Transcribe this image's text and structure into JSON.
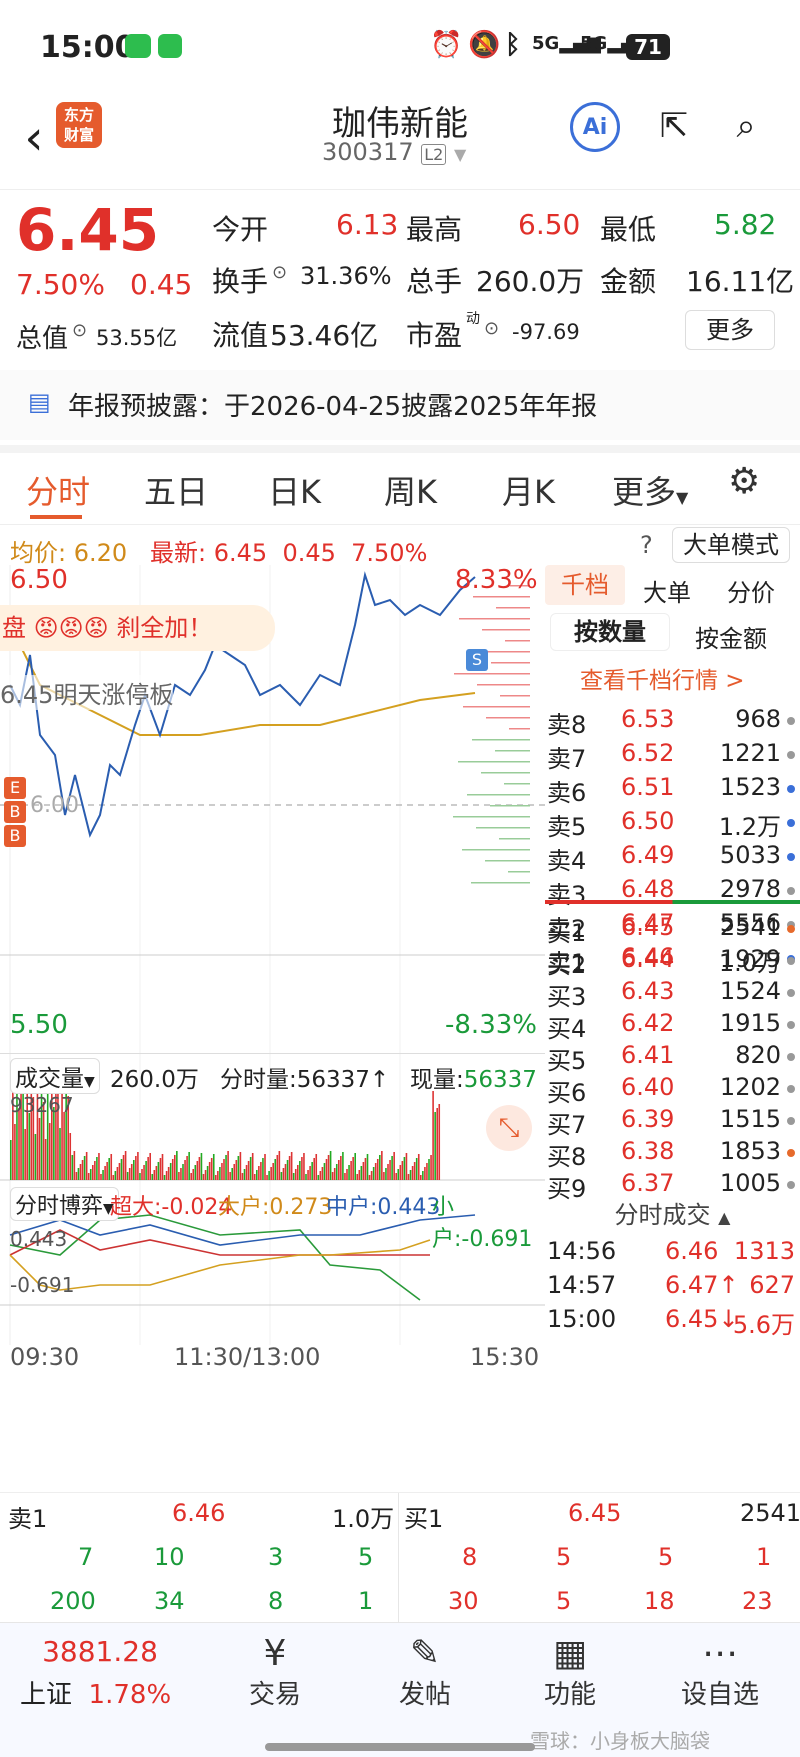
{
  "status": {
    "time": "15:00",
    "battery": "71",
    "network": "5G"
  },
  "header": {
    "logo_line1": "东方",
    "logo_line2": "财富",
    "stock_name": "珈伟新能",
    "stock_code": "300317",
    "level": "L2",
    "ai_label": "Ai"
  },
  "quote": {
    "price": "6.45",
    "change_pct": "7.50%",
    "change": "0.45",
    "open_label": "今开",
    "open": "6.13",
    "high_label": "最高",
    "high": "6.50",
    "low_label": "最低",
    "low": "5.82",
    "turnover_label": "换手",
    "turnover": "31.36%",
    "vol_label": "总手",
    "vol": "260.0万",
    "amount_label": "金额",
    "amount": "16.11亿",
    "mcap_label": "总值",
    "mcap": "53.55亿",
    "float_label": "流值",
    "float": "53.46亿",
    "pe_label": "市盈",
    "pe_sup": "动",
    "pe": "-97.69",
    "more_button": "更多"
  },
  "notice": {
    "text": "年报预披露：于2026-04-25披露2025年年报"
  },
  "tabs": [
    "分时",
    "五日",
    "日K",
    "周K",
    "月K",
    "更多"
  ],
  "infobar": {
    "avg_label": "均价:",
    "avg": "6.20",
    "latest_label": "最新:",
    "latest": "6.45",
    "chg": "0.45",
    "pct": "7.50%",
    "mode_button": "大单模式"
  },
  "chart": {
    "top_price": "6.50",
    "top_pct": "8.33%",
    "bottom_price": "5.50",
    "bottom_pct": "-8.33%",
    "mid_price": "6.00",
    "banner": "盘 😡😡😡 刹全加！",
    "promo": "6.45明天涨停板",
    "marker_s": "S",
    "markers": [
      "E",
      "B",
      "B"
    ],
    "vol_label": "成交量",
    "vol_total": "260.0万",
    "fs_vol": "分时量:56337↑",
    "now_vol_label": "现量:",
    "now_vol": "56337",
    "vol_max": "93267",
    "game_label": "分时博弈",
    "super_label": "超大:",
    "super_val": "-0.024",
    "big_label": "大户:",
    "big_val": "0.273",
    "mid_label": "中户:",
    "mid_val": "0.443",
    "small_label": "小户:",
    "small_val": "-0.691",
    "game_top": "0.443",
    "game_bottom": "-0.691",
    "time_start": "09:30",
    "time_mid": "11:30/13:00",
    "time_end": "15:30"
  },
  "orderbook": {
    "tabs": [
      "千档",
      "大单",
      "分价"
    ],
    "sub": [
      "按数量",
      "按金额"
    ],
    "link": "查看千档行情 >",
    "asks": [
      {
        "l": "卖8",
        "p": "6.53",
        "v": "968",
        "c": "#999"
      },
      {
        "l": "卖7",
        "p": "6.52",
        "v": "1221",
        "c": "#999"
      },
      {
        "l": "卖6",
        "p": "6.51",
        "v": "1523",
        "c": "#3b6fd8"
      },
      {
        "l": "卖5",
        "p": "6.50",
        "v": "1.2万",
        "c": "#3b6fd8"
      },
      {
        "l": "卖4",
        "p": "6.49",
        "v": "5033",
        "c": "#3b6fd8"
      },
      {
        "l": "卖3",
        "p": "6.48",
        "v": "2978",
        "c": "#999"
      },
      {
        "l": "卖2",
        "p": "6.47",
        "v": "5556",
        "c": "#999"
      },
      {
        "l": "卖1",
        "p": "6.46",
        "v": "1.0万",
        "c": "#3b6fd8"
      }
    ],
    "bids": [
      {
        "l": "买1",
        "p": "6.45",
        "v": "2541",
        "c": "#e66a2c"
      },
      {
        "l": "买2",
        "p": "6.44",
        "v": "1929",
        "c": "#999"
      },
      {
        "l": "买3",
        "p": "6.43",
        "v": "1524",
        "c": "#999"
      },
      {
        "l": "买4",
        "p": "6.42",
        "v": "1915",
        "c": "#999"
      },
      {
        "l": "买5",
        "p": "6.41",
        "v": "820",
        "c": "#999"
      },
      {
        "l": "买6",
        "p": "6.40",
        "v": "1202",
        "c": "#999"
      },
      {
        "l": "买7",
        "p": "6.39",
        "v": "1515",
        "c": "#999"
      },
      {
        "l": "买8",
        "p": "6.38",
        "v": "1853",
        "c": "#e66a2c"
      },
      {
        "l": "买9",
        "p": "6.37",
        "v": "1005",
        "c": "#999"
      }
    ],
    "trades_title": "分时成交",
    "trades": [
      {
        "t": "14:56",
        "p": "6.46",
        "v": "1313"
      },
      {
        "t": "14:57",
        "p": "6.47↑",
        "v": "627"
      },
      {
        "t": "15:00",
        "p": "6.45↓",
        "v": "5.6万"
      }
    ]
  },
  "bottom": {
    "sell1": "卖1",
    "sell1_p": "6.46",
    "sell1_v": "1.0万",
    "buy1": "买1",
    "buy1_p": "6.45",
    "buy1_v": "2541",
    "row1": [
      "7",
      "10",
      "3",
      "5",
      "8",
      "5",
      "5",
      "1"
    ],
    "row2": [
      "200",
      "34",
      "8",
      "1",
      "30",
      "5",
      "18",
      "23"
    ]
  },
  "nav": {
    "index_val": "3881.28",
    "index_name": "上证",
    "index_pct": "1.78%",
    "items": [
      "交易",
      "发帖",
      "功能",
      "设自选"
    ],
    "watermark": "雪球：小身板大脑袋"
  }
}
